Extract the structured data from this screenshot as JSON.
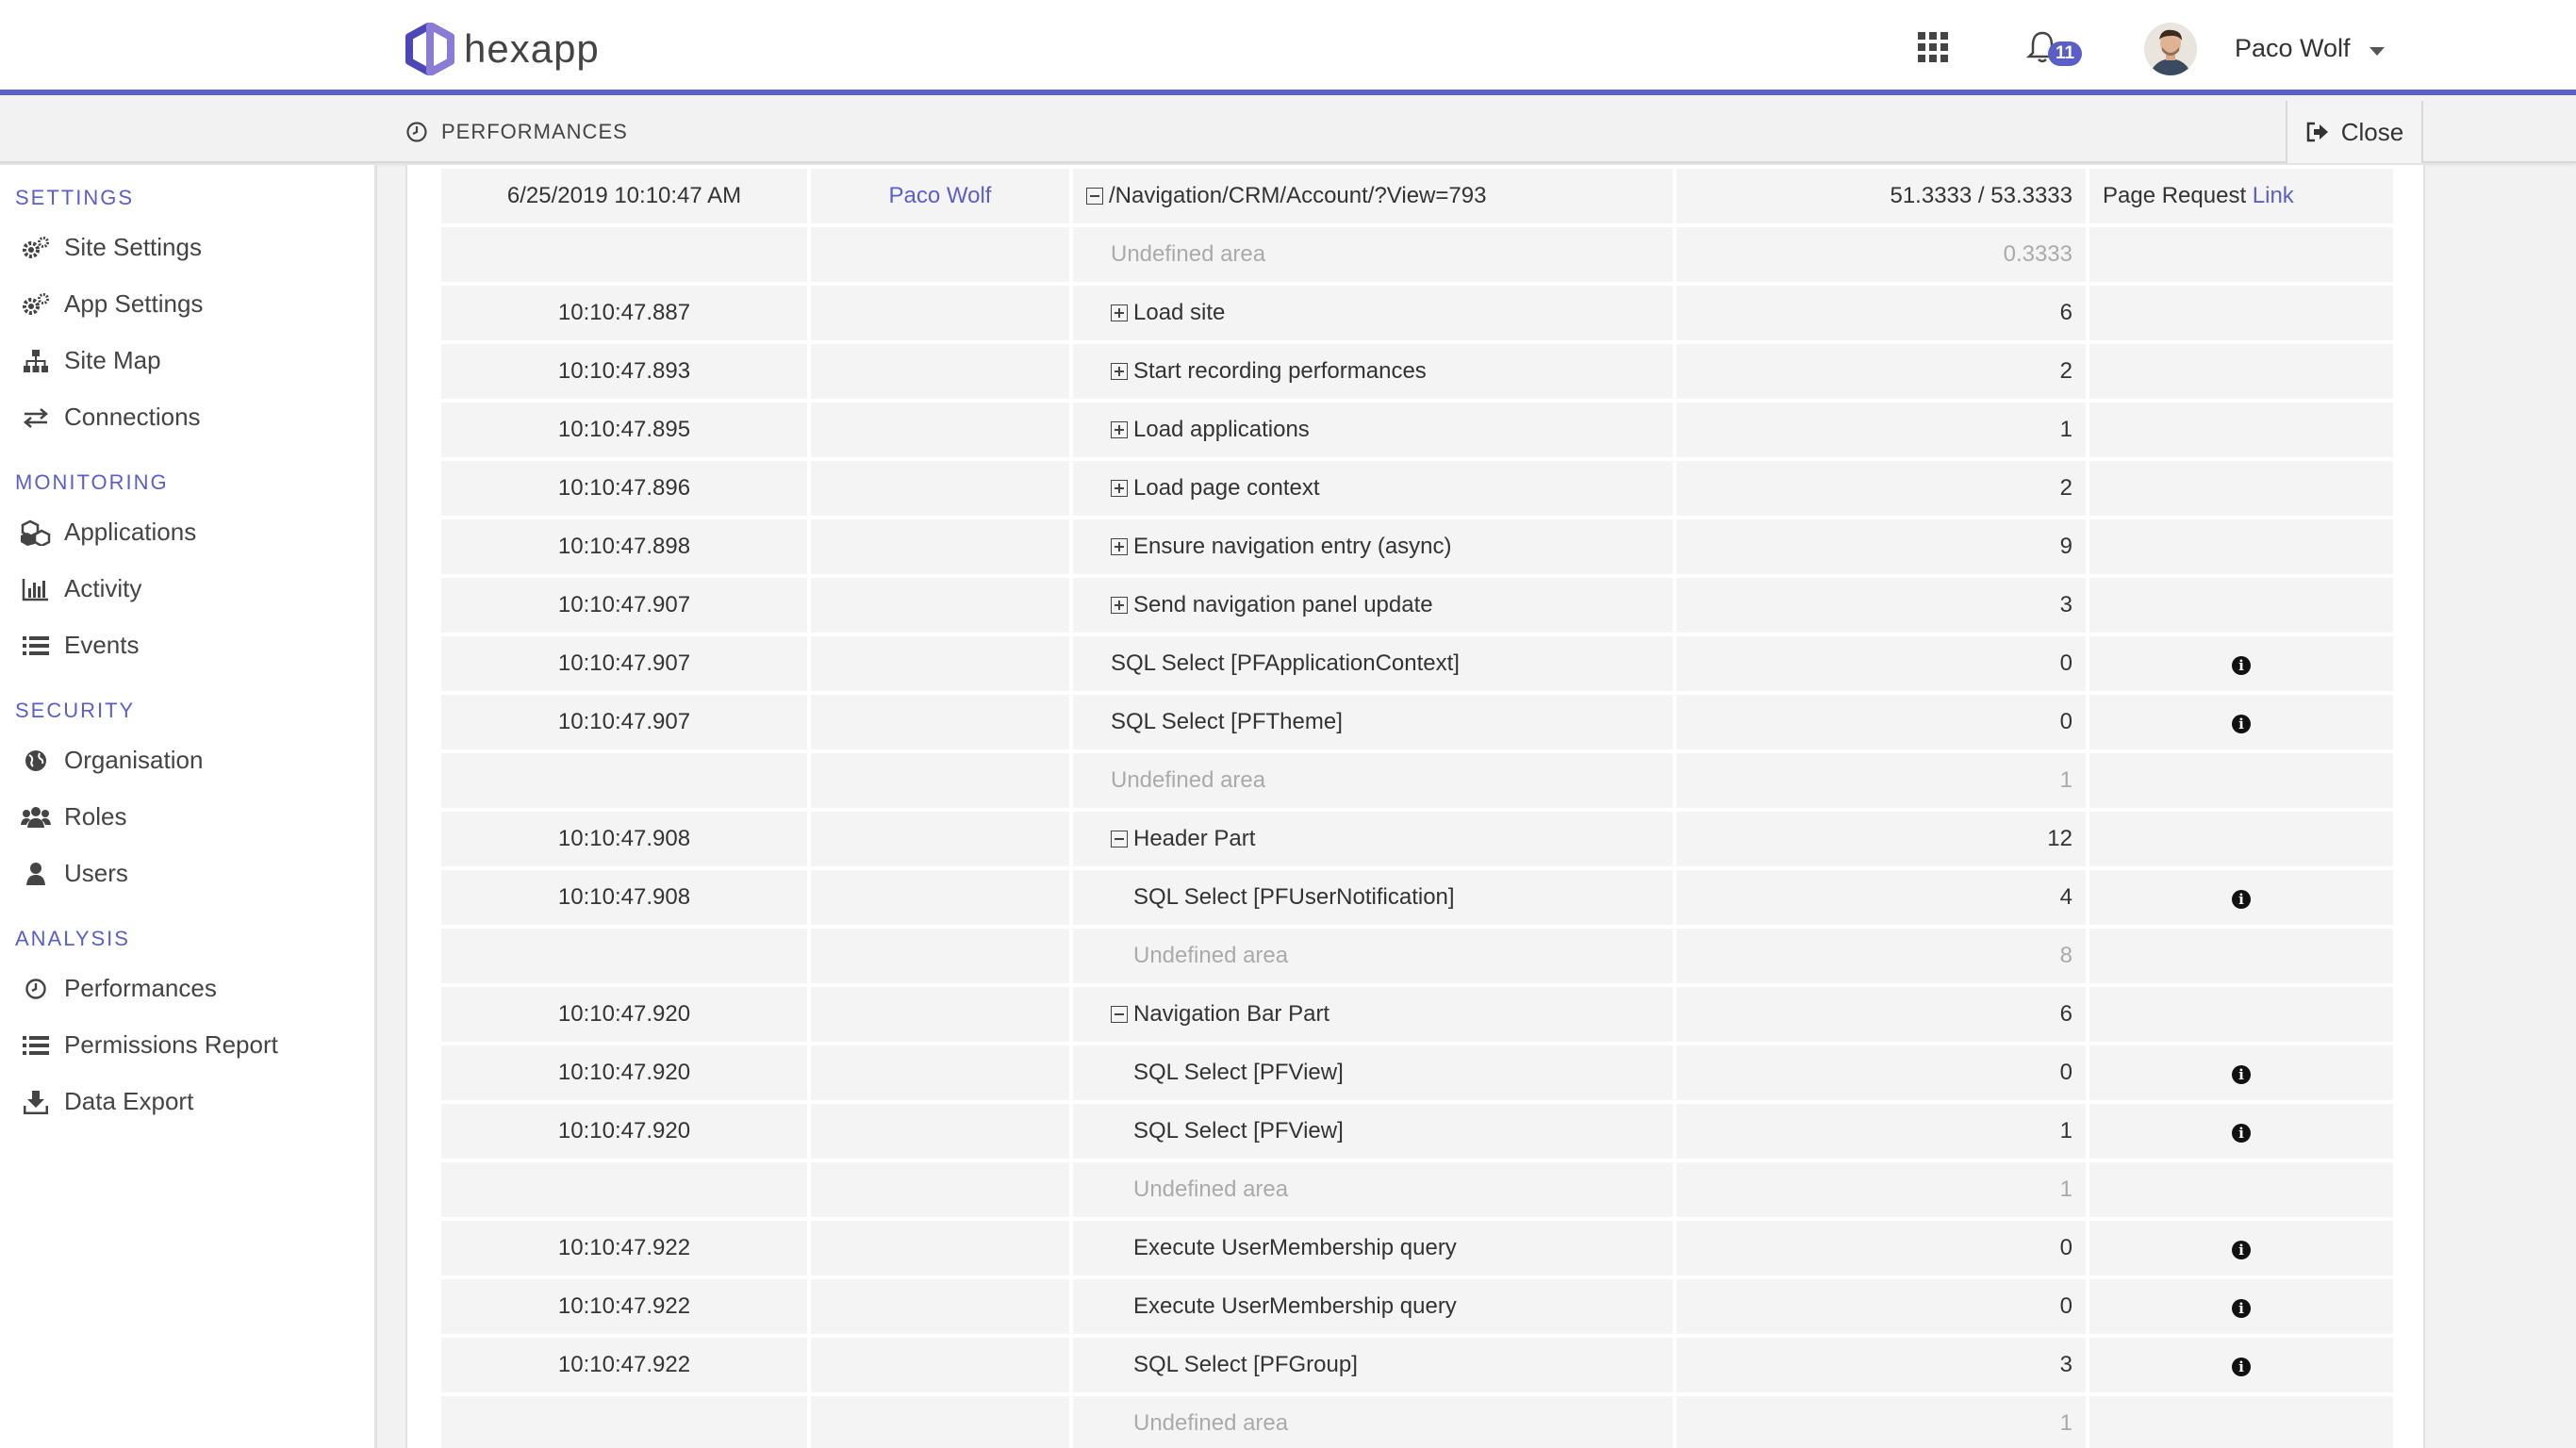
{
  "app": {
    "brand": "hexapp",
    "accent": "#5a5fc7"
  },
  "header": {
    "notifications_count": "11",
    "user_name": "Paco Wolf"
  },
  "subheader": {
    "title": "PERFORMANCES",
    "close_label": "Close"
  },
  "sidebar": {
    "settings_title": "SETTINGS",
    "settings": [
      "Site Settings",
      "App Settings",
      "Site Map",
      "Connections"
    ],
    "monitoring_title": "MONITORING",
    "monitoring": [
      "Applications",
      "Activity",
      "Events"
    ],
    "security_title": "SECURITY",
    "security": [
      "Organisation",
      "Roles",
      "Users"
    ],
    "analysis_title": "ANALYSIS",
    "analysis": [
      "Performances",
      "Permissions Report",
      "Data Export"
    ]
  },
  "table": {
    "header_row": {
      "datetime": "6/25/2019 10:10:47 AM",
      "user": "Paco Wolf",
      "path": "/Navigation/CRM/Account/?View=793",
      "duration": "51.3333 / 53.3333",
      "type": "Page Request",
      "link": "Link"
    },
    "rows": [
      {
        "time": "",
        "name": "Undefined area",
        "value": "0.3333",
        "muted": true,
        "indent": 0,
        "toggle": "",
        "info": false
      },
      {
        "time": "10:10:47.887",
        "name": "Load site",
        "value": "6",
        "muted": false,
        "indent": 0,
        "toggle": "plus",
        "info": false
      },
      {
        "time": "10:10:47.893",
        "name": "Start recording performances",
        "value": "2",
        "muted": false,
        "indent": 0,
        "toggle": "plus",
        "info": false
      },
      {
        "time": "10:10:47.895",
        "name": "Load applications",
        "value": "1",
        "muted": false,
        "indent": 0,
        "toggle": "plus",
        "info": false
      },
      {
        "time": "10:10:47.896",
        "name": "Load page context",
        "value": "2",
        "muted": false,
        "indent": 0,
        "toggle": "plus",
        "info": false
      },
      {
        "time": "10:10:47.898",
        "name": "Ensure navigation entry (async)",
        "value": "9",
        "muted": false,
        "indent": 0,
        "toggle": "plus",
        "info": false
      },
      {
        "time": "10:10:47.907",
        "name": "Send navigation panel update",
        "value": "3",
        "muted": false,
        "indent": 0,
        "toggle": "plus",
        "info": false
      },
      {
        "time": "10:10:47.907",
        "name": "SQL Select [PFApplicationContext]",
        "value": "0",
        "muted": false,
        "indent": 0,
        "toggle": "",
        "info": true
      },
      {
        "time": "10:10:47.907",
        "name": "SQL Select [PFTheme]",
        "value": "0",
        "muted": false,
        "indent": 0,
        "toggle": "",
        "info": true
      },
      {
        "time": "",
        "name": "Undefined area",
        "value": "1",
        "muted": true,
        "indent": 0,
        "toggle": "",
        "info": false
      },
      {
        "time": "10:10:47.908",
        "name": "Header Part",
        "value": "12",
        "muted": false,
        "indent": 0,
        "toggle": "minus",
        "info": false
      },
      {
        "time": "10:10:47.908",
        "name": "SQL Select [PFUserNotification]",
        "value": "4",
        "muted": false,
        "indent": 1,
        "toggle": "",
        "info": true
      },
      {
        "time": "",
        "name": "Undefined area",
        "value": "8",
        "muted": true,
        "indent": 1,
        "toggle": "",
        "info": false
      },
      {
        "time": "10:10:47.920",
        "name": "Navigation Bar Part",
        "value": "6",
        "muted": false,
        "indent": 0,
        "toggle": "minus",
        "info": false
      },
      {
        "time": "10:10:47.920",
        "name": "SQL Select [PFView]",
        "value": "0",
        "muted": false,
        "indent": 1,
        "toggle": "",
        "info": true
      },
      {
        "time": "10:10:47.920",
        "name": "SQL Select [PFView]",
        "value": "1",
        "muted": false,
        "indent": 1,
        "toggle": "",
        "info": true
      },
      {
        "time": "",
        "name": "Undefined area",
        "value": "1",
        "muted": true,
        "indent": 1,
        "toggle": "",
        "info": false
      },
      {
        "time": "10:10:47.922",
        "name": "Execute UserMembership query",
        "value": "0",
        "muted": false,
        "indent": 1,
        "toggle": "",
        "info": true
      },
      {
        "time": "10:10:47.922",
        "name": "Execute UserMembership query",
        "value": "0",
        "muted": false,
        "indent": 1,
        "toggle": "",
        "info": true
      },
      {
        "time": "10:10:47.922",
        "name": "SQL Select [PFGroup]",
        "value": "3",
        "muted": false,
        "indent": 1,
        "toggle": "",
        "info": true
      },
      {
        "time": "",
        "name": "Undefined area",
        "value": "1",
        "muted": true,
        "indent": 1,
        "toggle": "",
        "info": false
      }
    ]
  }
}
